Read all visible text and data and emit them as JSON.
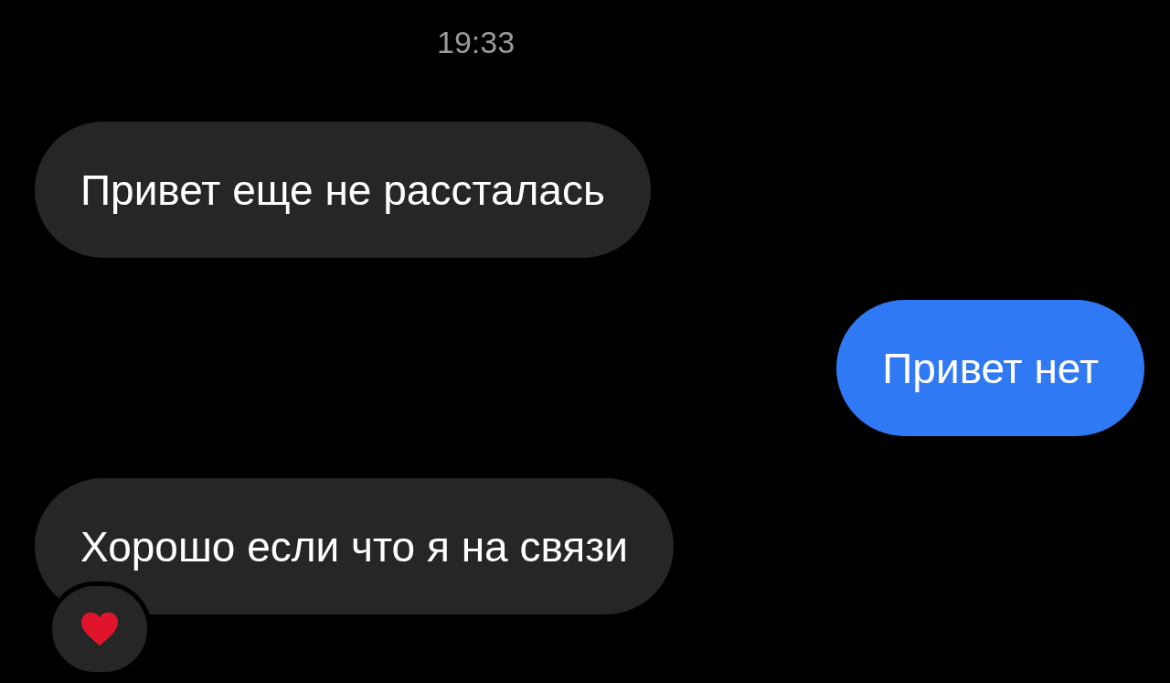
{
  "time": "19:33",
  "messages": [
    {
      "kind": "incoming",
      "text": "Привет еще не рассталась",
      "reacted": false
    },
    {
      "kind": "outgoing",
      "text": "Привет нет",
      "reacted": false
    },
    {
      "kind": "incoming",
      "text": "Хорошо если что я на связи",
      "reacted": true
    }
  ]
}
